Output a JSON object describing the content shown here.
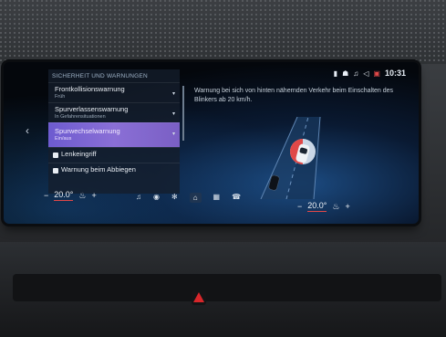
{
  "status": {
    "icons": [
      "phone-icon",
      "person-icon",
      "music-icon",
      "speaker-icon",
      "message-icon"
    ],
    "time": "10:31"
  },
  "panel": {
    "title": "SICHERHEIT UND WARNUNGEN",
    "items": [
      {
        "title": "Frontkollisionswarnung",
        "subtitle": "Früh"
      },
      {
        "title": "Spurverlassenswarnung",
        "subtitle": "In Gefahrensituationen"
      },
      {
        "title": "Spurwechselwarnung",
        "subtitle": "Ein/aus"
      },
      {
        "title": "Lenkeingriff",
        "subtitle": ""
      },
      {
        "title": "Warnung beim Abbiegen",
        "subtitle": ""
      }
    ]
  },
  "description": "Warnung bei sich von hinten nähernden Verkehr beim Einschalten des Blinkers ab 20 km/h.",
  "climate": {
    "left_temp": "20.0°",
    "right_temp": "20.0°",
    "minus": "−",
    "plus": "+"
  },
  "colors": {
    "selection": "#7a62d0",
    "accent_red": "#e04848",
    "hazard": "#d8262a"
  }
}
